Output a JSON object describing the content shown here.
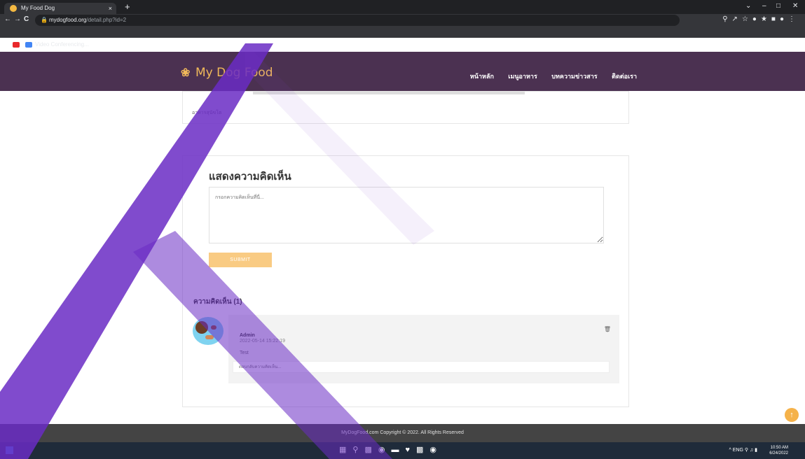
{
  "browser": {
    "tab_title": "My Food Dog",
    "tab_close": "×",
    "new_tab": "+",
    "url_host": "mydogfood.org",
    "url_path": "/detail.php?id=2",
    "bookmark_label": "Video Conferencing...",
    "window_controls": {
      "collapse": "⌄",
      "minimize": "–",
      "maximize": "□",
      "close": "✕"
    },
    "nav": {
      "back": "←",
      "forward": "→",
      "reload": "C"
    }
  },
  "site": {
    "logo_text": "My Dog Food",
    "menu": [
      "หน้าหลัก",
      "เมนูอาหาร",
      "บทความข่าวสาร",
      "ติดต่อเรา"
    ]
  },
  "article": {
    "snippet": "อาหารสุนัขโต"
  },
  "comment_form": {
    "heading": "แสดงความคิดเห็น",
    "placeholder": "กรอกความคิดเห็นที่นี่...",
    "submit_label": "SUBMIT"
  },
  "comments": {
    "count_label": "ความคิดเห็น (1)",
    "items": [
      {
        "author": "Admin",
        "date": "2022-05-14 15:22:19",
        "body": "Test",
        "reply_placeholder": "ตอบกลับความคิดเห็น..."
      }
    ]
  },
  "footer": {
    "copyright": "MyDogFood.com Copyright © 2022. All Rights Reserved"
  },
  "taskbar": {
    "language": "ENG",
    "time": "10:50 AM",
    "date": "6/24/2022"
  },
  "colors": {
    "header_bg": "#4b3151",
    "logo": "#f0b95a",
    "submit_bg": "#f9cb83",
    "footer_bg": "#444444",
    "to_top": "#f5b24a"
  }
}
